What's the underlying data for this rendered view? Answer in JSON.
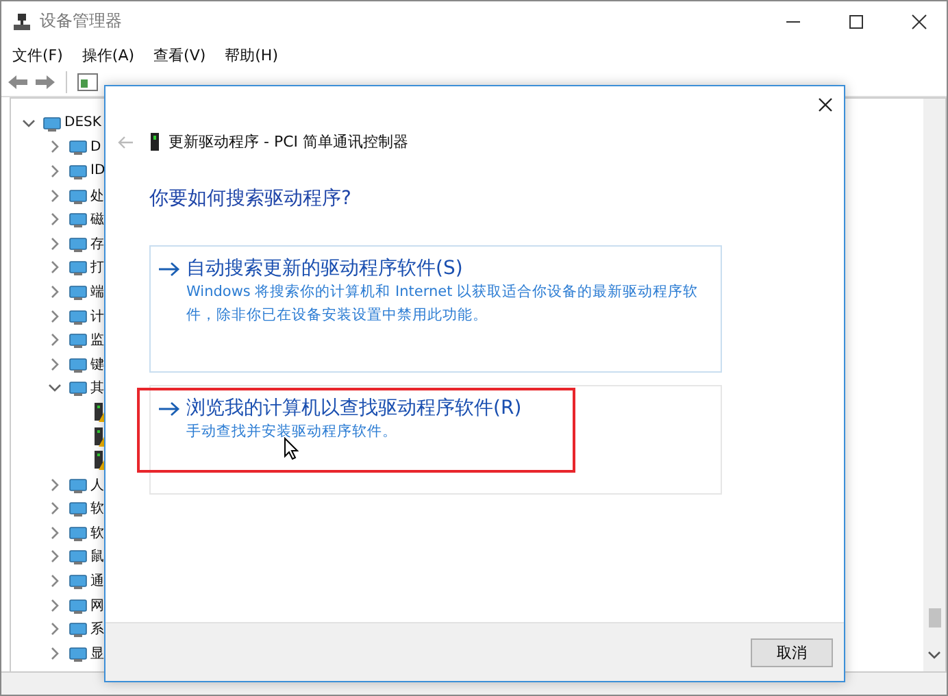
{
  "window": {
    "title": "设备管理器"
  },
  "menu": [
    "文件(F)",
    "操作(A)",
    "查看(V)",
    "帮助(H)"
  ],
  "tree": [
    {
      "label": "DESK",
      "expanded": true,
      "children": [
        {
          "label": "D",
          "expanded": false
        },
        {
          "label": "ID",
          "expanded": false
        },
        {
          "label": "处",
          "expanded": false
        },
        {
          "label": "磁",
          "expanded": false
        },
        {
          "label": "存",
          "expanded": false
        },
        {
          "label": "打",
          "expanded": false
        },
        {
          "label": "端",
          "expanded": false
        },
        {
          "label": "计",
          "expanded": false
        },
        {
          "label": "监",
          "expanded": false
        },
        {
          "label": "键",
          "expanded": false
        },
        {
          "label": "其",
          "expanded": true,
          "children": [
            {
              "warning": true
            },
            {
              "warning": true
            },
            {
              "warning": true
            }
          ]
        },
        {
          "label": "人",
          "expanded": false
        },
        {
          "label": "软",
          "expanded": false
        },
        {
          "label": "软",
          "expanded": false
        },
        {
          "label": "鼠",
          "expanded": false
        },
        {
          "label": "通",
          "expanded": false
        },
        {
          "label": "网",
          "expanded": false
        },
        {
          "label": "系",
          "expanded": false
        },
        {
          "label": "显",
          "expanded": false
        }
      ]
    }
  ],
  "dialog": {
    "title": "更新驱动程序 - PCI 简单通讯控制器",
    "heading": "你要如何搜索驱动程序?",
    "options": [
      {
        "title": "自动搜索更新的驱动程序软件(S)",
        "description": "Windows 将搜索你的计算机和 Internet 以获取适合你设备的最新驱动程序软件，除非你已在设备安装设置中禁用此功能。",
        "highlighted": false
      },
      {
        "title": "浏览我的计算机以查找驱动程序软件(R)",
        "description": "手动查找并安装驱动程序软件。",
        "highlighted": true
      }
    ],
    "buttons": [
      "取消"
    ]
  }
}
